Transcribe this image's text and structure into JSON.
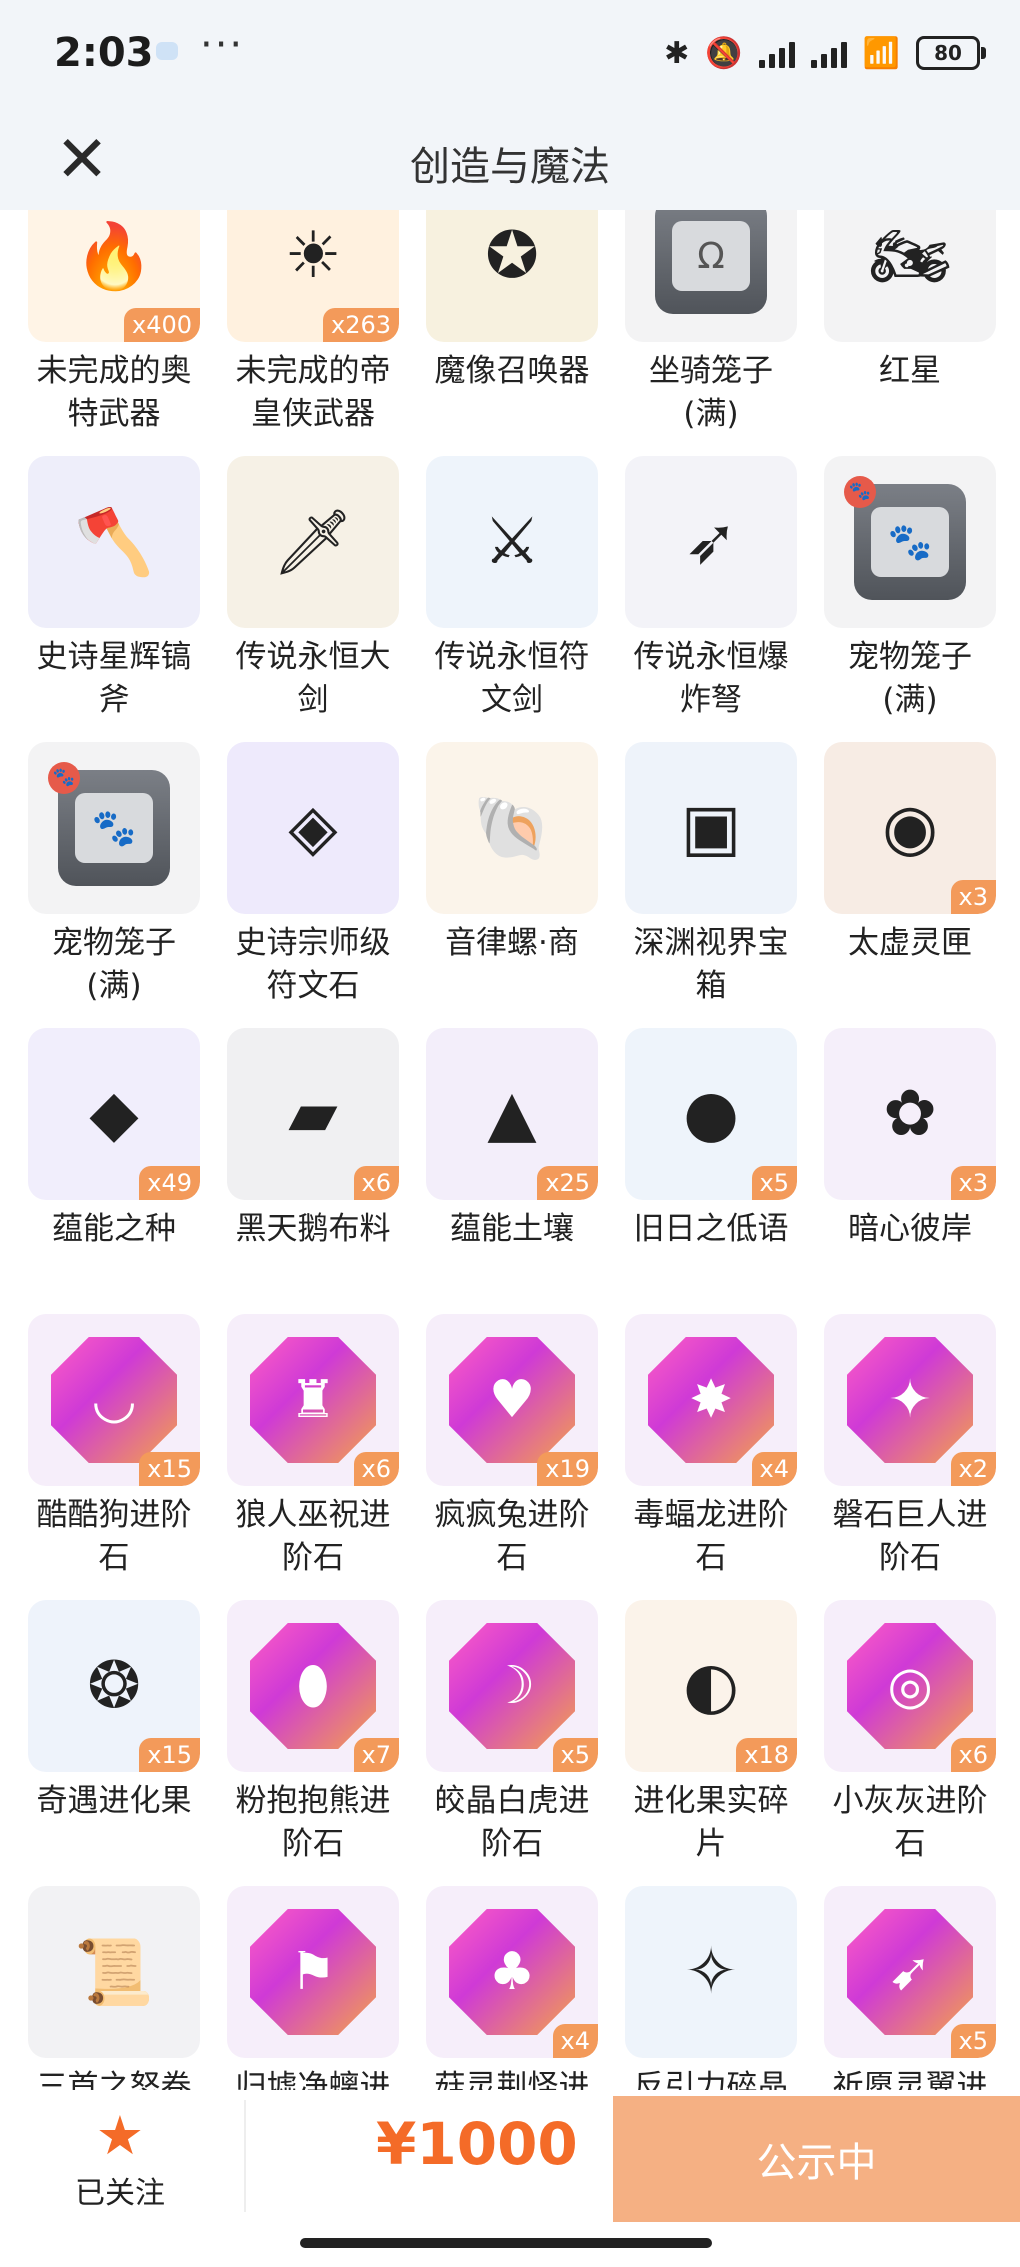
{
  "status_bar": {
    "time": "2:03",
    "dots": "···",
    "battery": "80"
  },
  "header": {
    "title": "创造与魔法",
    "close": "✕"
  },
  "items": [
    {
      "name": "未完成的奥特武器",
      "count": "x400",
      "icon": "flame-weapon-icon",
      "glyph": "🔥",
      "bg": "#fff4e6"
    },
    {
      "name": "未完成的帝皇侠武器",
      "count": "x263",
      "icon": "sun-weapon-icon",
      "glyph": "☀",
      "bg": "#fff1df"
    },
    {
      "name": "魔像召唤器",
      "count": "",
      "icon": "golem-summoner-icon",
      "glyph": "✪",
      "bg": "#f7f1df"
    },
    {
      "name": "坐骑笼子(满)",
      "count": "",
      "icon": "mount-cage-icon",
      "glyph": "Ω",
      "bg": "#f3f3f4"
    },
    {
      "name": "红星",
      "count": "",
      "icon": "motorcycle-icon",
      "glyph": "🏍",
      "bg": "#f3f3f4"
    },
    {
      "name": "史诗星辉镐斧",
      "count": "",
      "icon": "axe-icon",
      "glyph": "🪓",
      "bg": "#eeeefa"
    },
    {
      "name": "传说永恒大剑",
      "count": "",
      "icon": "greatsword-icon",
      "glyph": "🗡",
      "bg": "#f6f1e6"
    },
    {
      "name": "传说永恒符文剑",
      "count": "",
      "icon": "rune-sword-icon",
      "glyph": "⚔",
      "bg": "#eef4fb"
    },
    {
      "name": "传说永恒爆炸弩",
      "count": "",
      "icon": "crossbow-icon",
      "glyph": "➶",
      "bg": "#f3f3f8"
    },
    {
      "name": "宠物笼子(满)",
      "count": "",
      "icon": "pet-cage-icon",
      "glyph": "🐾",
      "bg": "#f3f3f4"
    },
    {
      "name": "宠物笼子(满)",
      "count": "",
      "icon": "pet-cage-icon",
      "glyph": "🐾",
      "bg": "#f3f3f4"
    },
    {
      "name": "史诗宗师级符文石",
      "count": "",
      "icon": "rune-stone-icon",
      "glyph": "◈",
      "bg": "#eeeafc"
    },
    {
      "name": "音律螺·商",
      "count": "",
      "icon": "conch-icon",
      "glyph": "🐚",
      "bg": "#fbf4ea"
    },
    {
      "name": "深渊视界宝箱",
      "count": "",
      "icon": "chest-icon",
      "glyph": "▣",
      "bg": "#eef3fa"
    },
    {
      "name": "太虚灵匣",
      "count": "x3",
      "icon": "spirit-box-icon",
      "glyph": "◉",
      "bg": "#f7ece4"
    },
    {
      "name": "蕴能之种",
      "count": "x49",
      "icon": "purple-crystal-icon",
      "glyph": "◆",
      "bg": "#f1eefc"
    },
    {
      "name": "黑天鹅布料",
      "count": "x6",
      "icon": "black-cloth-icon",
      "glyph": "▰",
      "bg": "#f0f0f2"
    },
    {
      "name": "蕴能土壤",
      "count": "x25",
      "icon": "purple-soil-icon",
      "glyph": "▲",
      "bg": "#f3eefa"
    },
    {
      "name": "旧日之低语",
      "count": "x5",
      "icon": "glowing-orb-icon",
      "glyph": "●",
      "bg": "#eef4fb"
    },
    {
      "name": "暗心彼岸",
      "count": "x3",
      "icon": "spider-lily-icon",
      "glyph": "✿",
      "bg": "#f5effa"
    },
    {
      "name": "酷酷狗进阶石",
      "count": "x15",
      "icon": "dog-evolution-stone-icon",
      "glyph": "◡",
      "bg": "#f6eefa",
      "gem": "gem-pink"
    },
    {
      "name": "狼人巫祝进阶石",
      "count": "x6",
      "icon": "werewolf-evolution-stone-icon",
      "glyph": "♜",
      "bg": "#f6eefa",
      "gem": "gem-pink"
    },
    {
      "name": "疯疯兔进阶石",
      "count": "x19",
      "icon": "rabbit-evolution-stone-icon",
      "glyph": "♥",
      "bg": "#f6eefa",
      "gem": "gem-pink"
    },
    {
      "name": "毒蝠龙进阶石",
      "count": "x4",
      "icon": "bat-dragon-evolution-stone-icon",
      "glyph": "✸",
      "bg": "#f6eefa",
      "gem": "gem-pink"
    },
    {
      "name": "磐石巨人进阶石",
      "count": "x2",
      "icon": "golem-evolution-stone-icon",
      "glyph": "✦",
      "bg": "#f6eefa",
      "gem": "gem-pink"
    },
    {
      "name": "奇遇进化果",
      "count": "x15",
      "icon": "evolution-fruit-icon",
      "glyph": "❂",
      "bg": "#eef3fb"
    },
    {
      "name": "粉抱抱熊进阶石",
      "count": "x7",
      "icon": "bear-evolution-stone-icon",
      "glyph": "⬮",
      "bg": "#f6eefa",
      "gem": "gem-pink"
    },
    {
      "name": "皎晶白虎进阶石",
      "count": "x5",
      "icon": "tiger-evolution-stone-icon",
      "glyph": "☽",
      "bg": "#f6eefa",
      "gem": "gem-pink"
    },
    {
      "name": "进化果实碎片",
      "count": "x18",
      "icon": "fruit-fragment-icon",
      "glyph": "◐",
      "bg": "#fbf3ea"
    },
    {
      "name": "小灰灰进阶石",
      "count": "x6",
      "icon": "wolf-evolution-stone-icon",
      "glyph": "◎",
      "bg": "#f6eefa",
      "gem": "gem-pink"
    },
    {
      "name": "三首之怒卷轴",
      "count": "",
      "icon": "scroll-icon",
      "glyph": "📜",
      "bg": "#f2f2f4"
    },
    {
      "name": "归墟净螭进阶石",
      "count": "",
      "icon": "dragon-evolution-stone-icon",
      "glyph": "⚑",
      "bg": "#f6eefa",
      "gem": "gem-pink"
    },
    {
      "name": "菇灵荆怪进阶石",
      "count": "x4",
      "icon": "mushroom-evolution-stone-icon",
      "glyph": "♣",
      "bg": "#f6eefa",
      "gem": "gem-pink"
    },
    {
      "name": "反引力碎晶",
      "count": "",
      "icon": "antigravity-crystal-icon",
      "glyph": "✧",
      "bg": "#eef4fb"
    },
    {
      "name": "祈愿灵翼进阶石",
      "count": "x5",
      "icon": "wing-evolution-stone-icon",
      "glyph": "➹",
      "bg": "#f6eefa",
      "gem": "gem-pink"
    }
  ],
  "footer": {
    "follow_label": "已关注",
    "price": "¥1000",
    "status": "公示中"
  },
  "colors": {
    "accent": "#f46b28",
    "badge": "#f39a5a",
    "button": "#f5b083"
  }
}
